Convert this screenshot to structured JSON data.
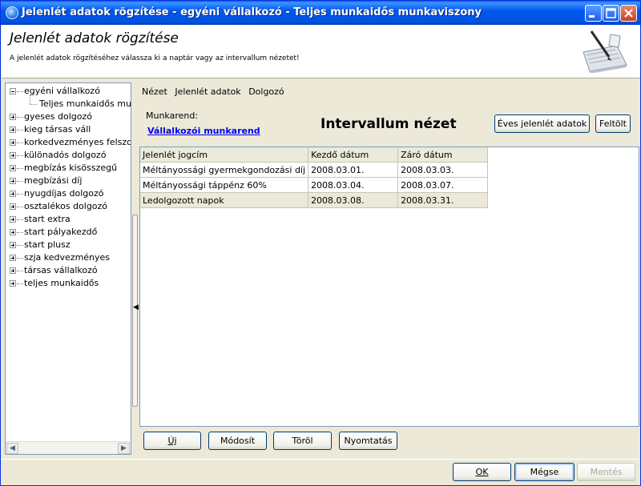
{
  "window": {
    "title": "Jelenlét adatok rögzítése - egyéni vállalkozó - Teljes munkaidős munkaviszony"
  },
  "header": {
    "title": "Jelenlét adatok rögzítése",
    "description": "A jelenlét adatok rögzítéséhez válassza ki a naptár vagy az intervallum nézetet!"
  },
  "tree": {
    "root": "egyéni vállalkozó",
    "child": "Teljes munkaidős munkaviszony",
    "items": [
      "gyeses dolgozó",
      "kieg társas váll",
      "korkedvezményes felszolgáló",
      "különadós dolgozó",
      "megbízás kisösszegű",
      "megbízási díj",
      "nyugdíjas dolgozó",
      "osztalékos dolgozó",
      "start extra",
      "start pályakezdő",
      "start plusz",
      "szja kedvezményes",
      "társas vállalkozó",
      "teljes munkaidős"
    ]
  },
  "menu": {
    "items": [
      "Nézet",
      "Jelenlét adatok",
      "Dolgozó"
    ]
  },
  "panel": {
    "munkarend_label": "Munkarend:",
    "munkarend_link": "Vállalkozói munkarend",
    "view_title": "Intervallum nézet",
    "eves_button": "Éves jelenlét adatok",
    "feltolt_button": "Feltölt"
  },
  "table": {
    "columns": [
      "Jelenlét jogcím",
      "Kezdő dátum",
      "Záró dátum"
    ],
    "rows": [
      [
        "Méltányossági gyermekgondozási díj",
        "2008.03.01.",
        "2008.03.03."
      ],
      [
        "Méltányossági táppénz 60%",
        "2008.03.04.",
        "2008.03.07."
      ],
      [
        "Ledolgozott napok",
        "2008.03.08.",
        "2008.03.31."
      ]
    ]
  },
  "actions": {
    "uj": "Új",
    "modosit": "Módosít",
    "torol": "Töröl",
    "nyomtatas": "Nyomtatás"
  },
  "dialog": {
    "ok": "OK",
    "megse": "Mégse",
    "mentes": "Mentés"
  },
  "colors": {
    "titlebar": "#0058ee",
    "link": "#0000ee",
    "selected_row": "#ece9d8"
  }
}
